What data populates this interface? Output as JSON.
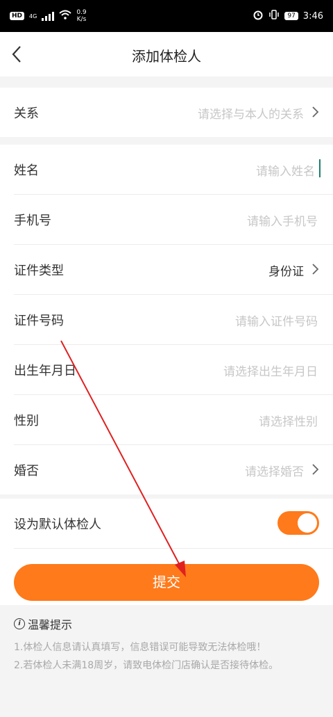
{
  "status_bar": {
    "hd": "HD",
    "network": "4G",
    "speed_value": "0.9",
    "speed_unit": "K/s",
    "battery": "97",
    "time": "3:46"
  },
  "header": {
    "title": "添加体检人"
  },
  "relation": {
    "label": "关系",
    "placeholder": "请选择与本人的关系"
  },
  "form": {
    "name": {
      "label": "姓名",
      "placeholder": "请输入姓名"
    },
    "phone": {
      "label": "手机号",
      "placeholder": "请输入手机号"
    },
    "id_type": {
      "label": "证件类型",
      "value": "身份证"
    },
    "id_number": {
      "label": "证件号码",
      "placeholder": "请输入证件号码"
    },
    "birthday": {
      "label": "出生年月日",
      "placeholder": "请选择出生年月日"
    },
    "gender": {
      "label": "性别",
      "placeholder": "请选择性别"
    },
    "marital": {
      "label": "婚否",
      "placeholder": "请选择婚否"
    }
  },
  "default_setting": {
    "label": "设为默认体检人",
    "enabled": true
  },
  "submit_label": "提交",
  "tips": {
    "title": "温馨提示",
    "items": [
      "1.体检人信息请认真填写，信息错误可能导致无法体检哦！",
      "2.若体检人未满18周岁，请致电体检门店确认是否接待体检。"
    ]
  },
  "colors": {
    "accent": "#ff7a1a",
    "annotation_arrow": "#e02020"
  }
}
